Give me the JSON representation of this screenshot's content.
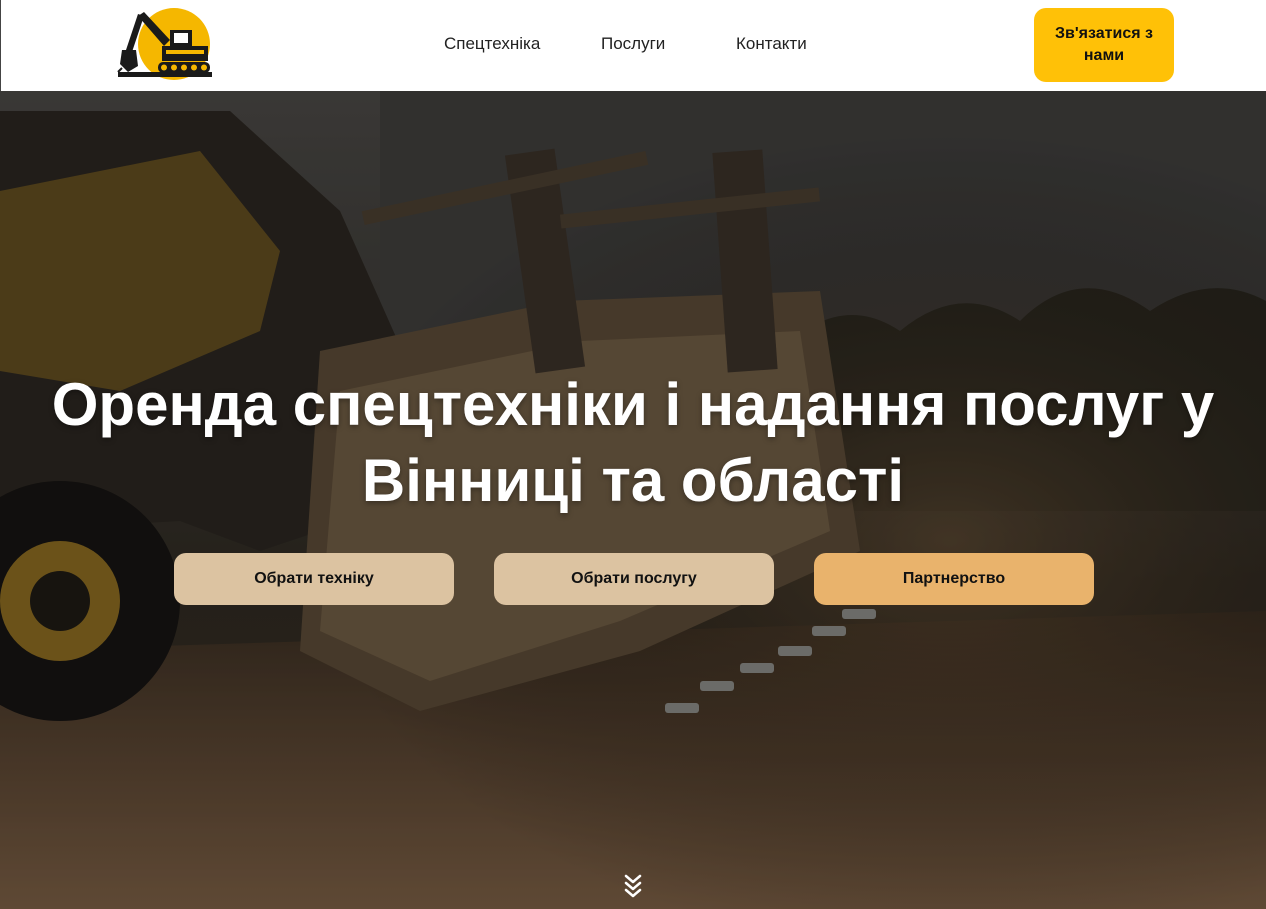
{
  "header": {
    "logo_name": "excavator-logo",
    "nav": [
      {
        "label": "Спецтехніка"
      },
      {
        "label": "Послуги"
      },
      {
        "label": "Контакти"
      }
    ],
    "contact_button": "Зв'язатися з нами"
  },
  "hero": {
    "title": "Оренда спецтехніки і надання послуг у Вінниці та області",
    "buttons": [
      {
        "label": "Обрати техніку"
      },
      {
        "label": "Обрати послугу"
      },
      {
        "label": "Партнерство"
      }
    ],
    "scroll_icon": "double-chevron-down-icon"
  },
  "colors": {
    "accent": "#ffc107",
    "button_light": "#dcc3a1",
    "button_orange": "#e9b36c",
    "hero_text": "#ffffff"
  }
}
